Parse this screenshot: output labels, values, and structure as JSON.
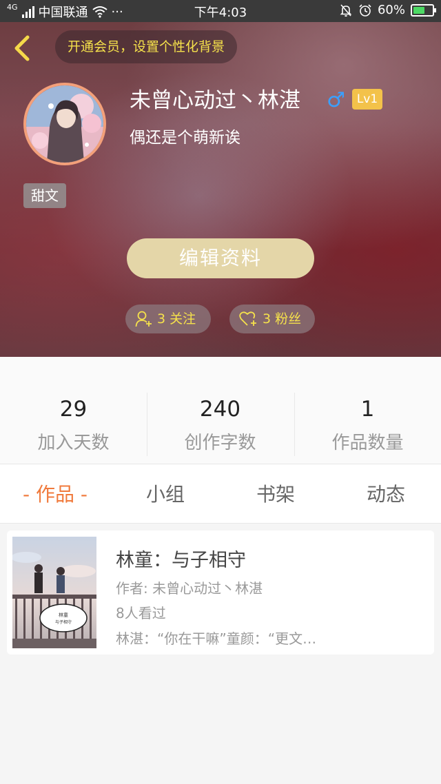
{
  "status_bar": {
    "net_type": "4G",
    "carrier": "中国联通",
    "dots": "···",
    "time": "下午4:03",
    "battery": "60%",
    "battery_level": 0.6
  },
  "header": {
    "vip_prompt": "开通会员，设置个性化背景",
    "username": "未曾心动过丶林湛",
    "gender_symbol": "♂",
    "level": "Lv1",
    "bio": "偶还是个萌新诶",
    "tag": "甜文",
    "edit_button": "编辑资料",
    "follow_label": "3 关注",
    "fans_label": "3 粉丝"
  },
  "stats": [
    {
      "value": "29",
      "label": "加入天数"
    },
    {
      "value": "240",
      "label": "创作字数"
    },
    {
      "value": "1",
      "label": "作品数量"
    }
  ],
  "tabs": [
    {
      "label": "- 作品 -",
      "active": true
    },
    {
      "label": "小组",
      "active": false
    },
    {
      "label": "书架",
      "active": false
    },
    {
      "label": "动态",
      "active": false
    }
  ],
  "works": [
    {
      "title": "林童：与子相守",
      "author": "作者: 未曾心动过丶林湛",
      "views": "8人看过",
      "excerpt": "林湛：“你在干嘛”童颜：“更文…"
    }
  ],
  "colors": {
    "accent": "#f07a3c",
    "vip_text": "#f6e24b",
    "level_badge": "#f3c24a",
    "gender": "#3aa0ff",
    "edit_button": "#e4d6a8"
  }
}
